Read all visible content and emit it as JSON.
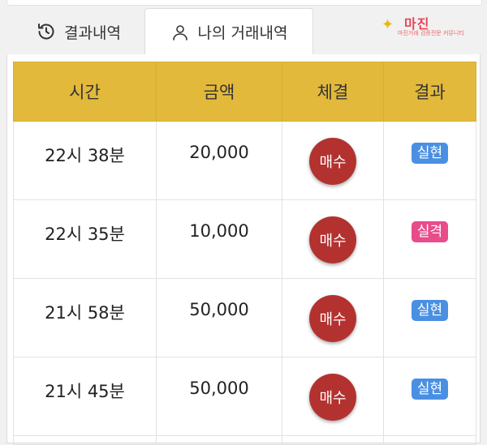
{
  "tabs": [
    {
      "label": "결과내역",
      "icon": "history-icon",
      "active": false
    },
    {
      "label": "나의 거래내역",
      "icon": "user-icon",
      "active": true
    }
  ],
  "logo": {
    "name": "마진",
    "tagline": "마진거래 검증전문 커뮤니티"
  },
  "table": {
    "headers": [
      "시간",
      "금액",
      "체결",
      "결과"
    ],
    "rows": [
      {
        "time": "22시 38분",
        "amount": "20,000",
        "trade": "매수",
        "result": "실현"
      },
      {
        "time": "22시 35분",
        "amount": "10,000",
        "trade": "매수",
        "result": "실격"
      },
      {
        "time": "21시 58분",
        "amount": "50,000",
        "trade": "매수",
        "result": "실현"
      },
      {
        "time": "21시 45분",
        "amount": "50,000",
        "trade": "매수",
        "result": "실현"
      }
    ]
  },
  "colors": {
    "header": "#e2b93b",
    "buy": "#b3322f",
    "result_success": "#4a90e2",
    "result_fail": "#e84c8b"
  }
}
